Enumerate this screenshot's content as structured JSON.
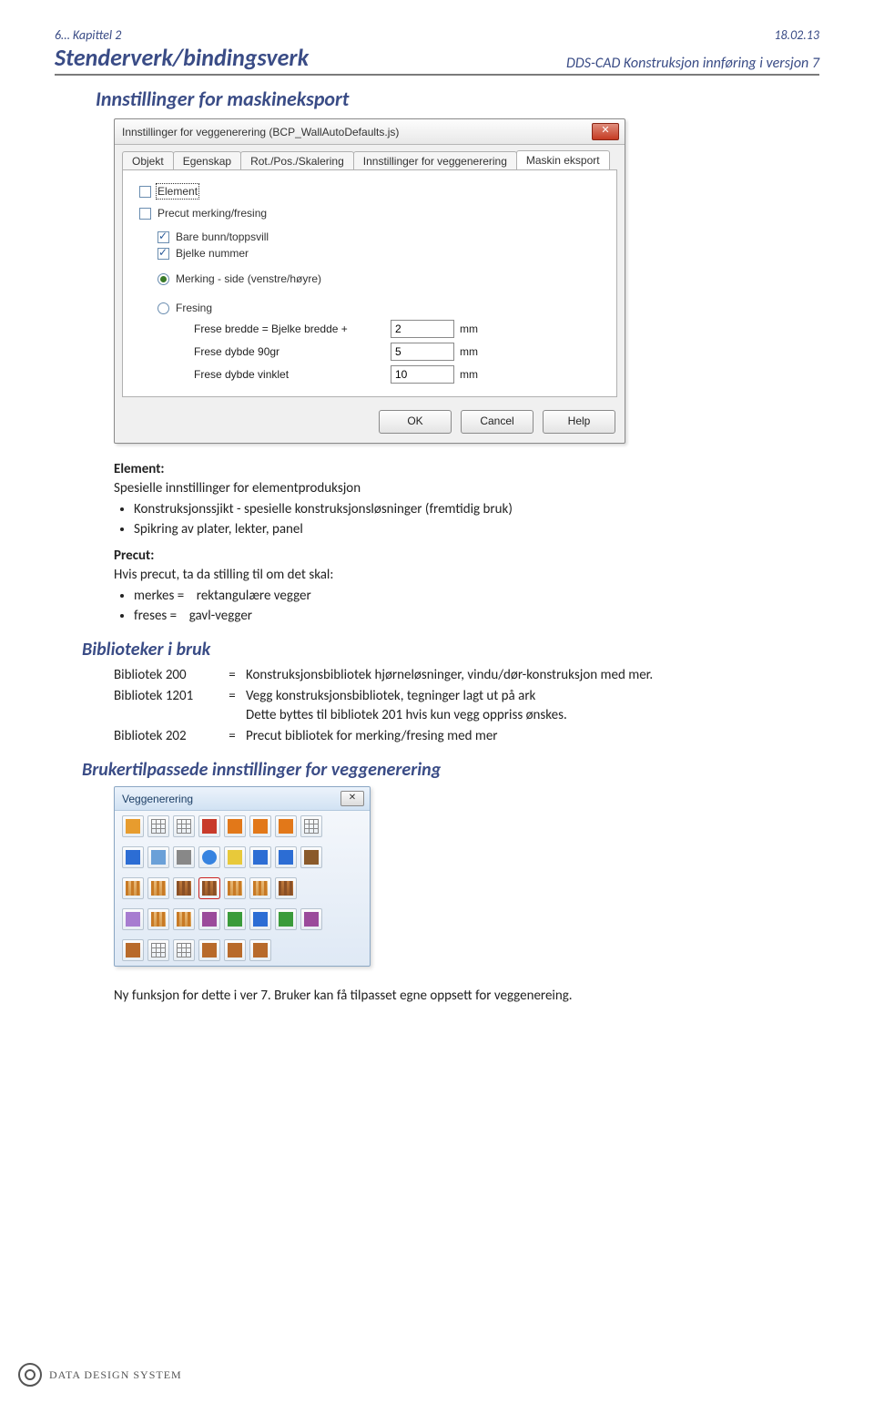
{
  "header": {
    "chapter": "6… Kapittel 2",
    "date": "18.02.13",
    "title_left": "Stenderverk/bindingsverk",
    "title_right": "DDS-CAD Konstruksjon innføring i versjon  7"
  },
  "section1": {
    "heading": "Innstillinger for maskineksport"
  },
  "dialog": {
    "title": "Innstillinger for veggenerering (BCP_WallAutoDefaults.js)",
    "tabs": [
      "Objekt",
      "Egenskap",
      "Rot./Pos./Skalering",
      "Innstillinger for veggenerering",
      "Maskin eksport"
    ],
    "active_tab_index": 4,
    "element_label": "Element",
    "precut_label": "Precut merking/fresing",
    "bunn_label": "Bare bunn/toppsvill",
    "bjelke_label": "Bjelke nummer",
    "merking_label": "Merking - side (venstre/høyre)",
    "fresing_label": "Fresing",
    "frese_rows": [
      {
        "label": "Frese bredde = Bjelke bredde  +",
        "value": "2",
        "unit": "mm"
      },
      {
        "label": "Frese dybde 90gr",
        "value": "5",
        "unit": "mm"
      },
      {
        "label": "Frese dybde vinklet",
        "value": "10",
        "unit": "mm"
      }
    ],
    "buttons": {
      "ok": "OK",
      "cancel": "Cancel",
      "help": "Help"
    }
  },
  "element_block": {
    "heading": "Element:",
    "intro": "Spesielle innstillinger for elementproduksjon",
    "bullets": [
      "Konstruksjonssjikt - spesielle konstruksjonsløsninger (fremtidig bruk)",
      "Spikring av plater, lekter, panel"
    ]
  },
  "precut_block": {
    "heading": "Precut:",
    "intro": "Hvis precut, ta da stilling til om det skal:",
    "items": [
      {
        "label": "merkes =",
        "desc": "rektangulære vegger"
      },
      {
        "label": "freses  =",
        "desc": "gavl-vegger"
      }
    ]
  },
  "libs": {
    "heading": "Biblioteker i bruk",
    "rows": [
      {
        "name": "Bibliotek 200",
        "desc": "Konstruksjonsbibliotek hjørneløsninger, vindu/dør-konstruksjon med mer."
      },
      {
        "name": "Bibliotek 1201",
        "desc": "Vegg konstruksjonsbibliotek, tegninger lagt ut på ark\nDette byttes til bibliotek 201 hvis kun vegg oppriss ønskes."
      },
      {
        "name": "Bibliotek 202",
        "desc": "Precut bibliotek for merking/fresing med mer"
      }
    ]
  },
  "custom": {
    "heading": "Brukertilpassede innstillinger for veggenerering"
  },
  "small_dialog": {
    "title": "Veggenerering"
  },
  "footnote": "Ny  funksjon  for  dette  i  ver  7.  Bruker  kan  få  tilpasset  egne  oppsett  for veggenereing.",
  "footer_text": "DATA DESIGN SYSTEM"
}
